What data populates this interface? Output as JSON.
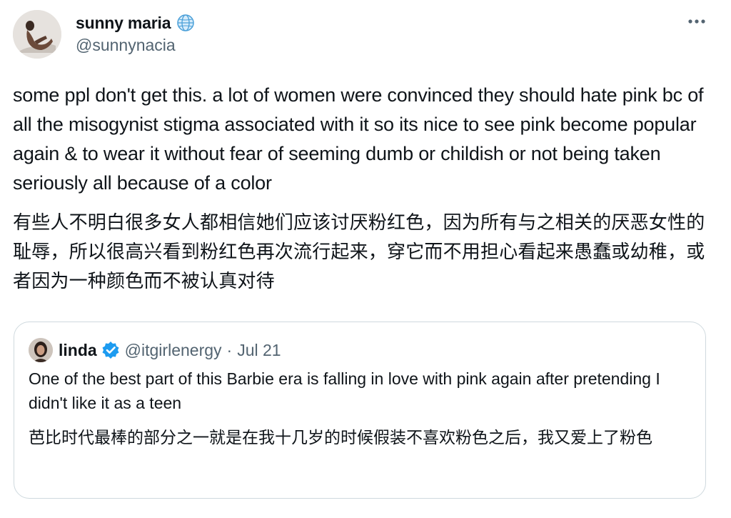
{
  "tweet": {
    "author": {
      "display_name": "sunny maria",
      "handle": "@sunnynacia",
      "badge_icon": "globe-icon"
    },
    "more_icon": "more-horizontal-icon",
    "text_en": "some ppl don't get this. a lot of women were convinced they should hate pink bc of all the misogynist stigma associated with it so its nice to see pink become popular again & to wear it without fear of seeming dumb or childish or not being taken seriously all because of a color",
    "text_zh": "有些人不明白很多女人都相信她们应该讨厌粉红色，因为所有与之相关的厌恶女性的耻辱，所以很高兴看到粉红色再次流行起来，穿它而不用担心看起来愚蠢或幼稚，或者因为一种颜色而不被认真对待"
  },
  "quoted_tweet": {
    "display_name": "linda",
    "verified_icon": "verified-badge-icon",
    "handle": "@itgirlenergy",
    "separator": "·",
    "date": "Jul 21",
    "text_en": "One of the best part of this Barbie era is falling in love with pink again after pretending I didn't like it as a teen",
    "text_zh": "芭比时代最棒的部分之一就是在我十几岁的时候假装不喜欢粉色之后，我又爱上了粉色"
  },
  "colors": {
    "text_primary": "#0f1419",
    "text_secondary": "#536471",
    "border": "#cfd9de",
    "verified_blue": "#1d9bf0"
  }
}
